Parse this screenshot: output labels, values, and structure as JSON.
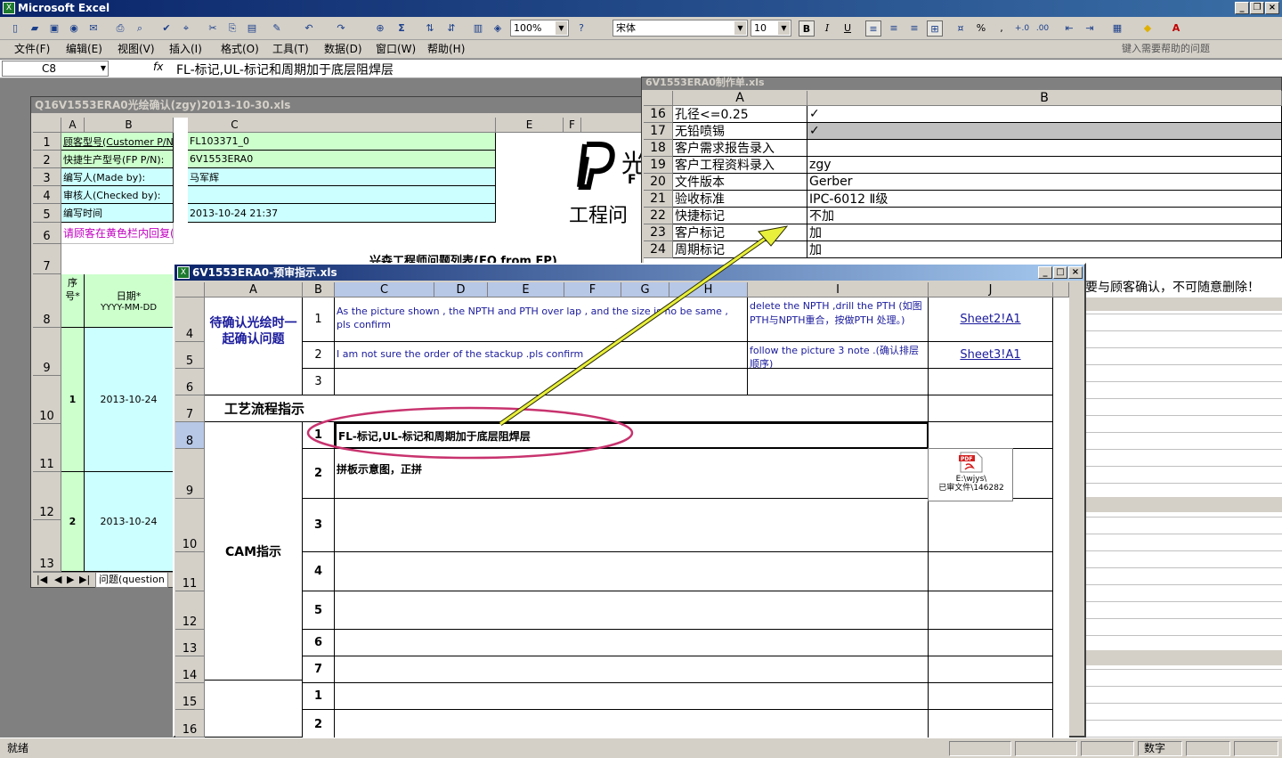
{
  "app": {
    "title": "Microsoft Excel",
    "icon": "excel-icon"
  },
  "toolbar": {
    "zoom": "100%",
    "font_name": "宋体",
    "font_size": "10",
    "bold": "B",
    "italic": "I",
    "underline": "U",
    "sigma": "Σ",
    "percent": "%",
    "comma": ","
  },
  "menu": [
    "文件(F)",
    "编辑(E)",
    "视图(V)",
    "插入(I)",
    "格式(O)",
    "工具(T)",
    "数据(D)",
    "窗口(W)",
    "帮助(H)"
  ],
  "help_placeholder": "键入需要帮助的问题",
  "formula_bar": {
    "name_box": "C8",
    "fx": "fx",
    "content": "FL-标记,UL-标记和周期加于底层阻焊层"
  },
  "left_window": {
    "title": "Q16V1553ERA0光绘确认(zgy)2013-10-30.xls",
    "columns": [
      "A",
      "B",
      "C",
      "D",
      "E",
      "F"
    ],
    "rows": [
      "1",
      "2",
      "3",
      "4",
      "5",
      "6",
      "7",
      "8",
      "9",
      "10",
      "11",
      "12",
      "13"
    ],
    "fields": [
      {
        "label": "顾客型号(Customer P/N):",
        "value": "FL103371_0"
      },
      {
        "label": "快捷生产型号(FP P/N):",
        "value": "6V1553ERA0"
      },
      {
        "label": "编写人(Made by):",
        "value": "马军辉"
      },
      {
        "label": "审核人(Checked by):",
        "value": ""
      },
      {
        "label": "编写时间",
        "value": "2013-10-24 21:37"
      }
    ],
    "note": "请顾客在黄色栏内回复(NOTE:Customer's answer in column yellow area)",
    "logo_text": "光",
    "logo_sub": "F",
    "heading_partial": "工程问",
    "list_heading": "兴森工程师问题列表(EQ from FP)",
    "header_seq": "序号*",
    "header_date": "日期*",
    "header_date_fmt": "YYYY-MM-DD",
    "items": [
      {
        "seq": "1",
        "date": "2013-10-24"
      },
      {
        "seq": "2",
        "date": "2013-10-24"
      }
    ],
    "sheet_tab": "问题(question"
  },
  "right_window": {
    "title": "6V1553ERA0制作单.xls",
    "columns": [
      "A",
      "B"
    ],
    "rows": [
      {
        "n": "16",
        "a": "孔径<=0.25",
        "b": "✓"
      },
      {
        "n": "17",
        "a": "无铅喷锡",
        "b": "✓"
      },
      {
        "n": "18",
        "a": "客户需求报告录入",
        "b": ""
      },
      {
        "n": "19",
        "a": "客户工程资料录入",
        "b": "zgy"
      },
      {
        "n": "20",
        "a": "文件版本",
        "b": "Gerber"
      },
      {
        "n": "21",
        "a": "验收标准",
        "b": "IPC-6012 Ⅱ级"
      },
      {
        "n": "22",
        "a": "快捷标记",
        "b": "不加"
      },
      {
        "n": "23",
        "a": "客户标记",
        "b": "加"
      },
      {
        "n": "24",
        "a": "周期标记",
        "b": "加"
      }
    ],
    "overflow_text": "要与顾客确认，不可随意删除！"
  },
  "front_window": {
    "title": "6V1553ERA0-预审指示.xls",
    "columns": [
      "A",
      "B",
      "C",
      "D",
      "E",
      "F",
      "G",
      "H",
      "I",
      "J"
    ],
    "row_nums": [
      "4",
      "5",
      "6",
      "7",
      "8",
      "9",
      "10",
      "11",
      "12",
      "13",
      "14",
      "15",
      "16"
    ],
    "section1_label": "待确认光绘时一起确认问题",
    "q1": "As the picture shown , the NPTH and PTH over lap , and the size is no be same , pls confirm",
    "q1_answer": "delete the NPTH ,drill the PTH (如图PTH与NPTH重合，按做PTH 处理。)",
    "q1_link": "Sheet2!A1",
    "q2": "I am not sure the order of the stackup .pls confirm",
    "q2_answer": "follow the picture 3 note .(确认排层顺序)",
    "q2_link": "Sheet3!A1",
    "process_label": "工艺流程指示",
    "cam_label": "CAM指示",
    "cam1": "FL-标记,UL-标记和周期加于底层阻焊层",
    "cam2": "拼板示意图，正拼",
    "numbers_sec1": [
      "1",
      "2",
      "3"
    ],
    "numbers_cam": [
      "1",
      "2",
      "3",
      "4",
      "5",
      "6",
      "7"
    ],
    "numbers_next": [
      "1",
      "2"
    ],
    "attachment": {
      "icon": "pdf-icon",
      "line1": "E:\\wjys\\",
      "line2": "已审文件\\146282"
    }
  },
  "status": {
    "left": "就绪",
    "mode": "数字"
  },
  "colors": {
    "highlight_ellipse": "#c8336e",
    "arrow": "#e8f03c",
    "green_cell": "#ccffcc",
    "cyan_cell": "#ccffff",
    "link": "#1a1a9c"
  }
}
